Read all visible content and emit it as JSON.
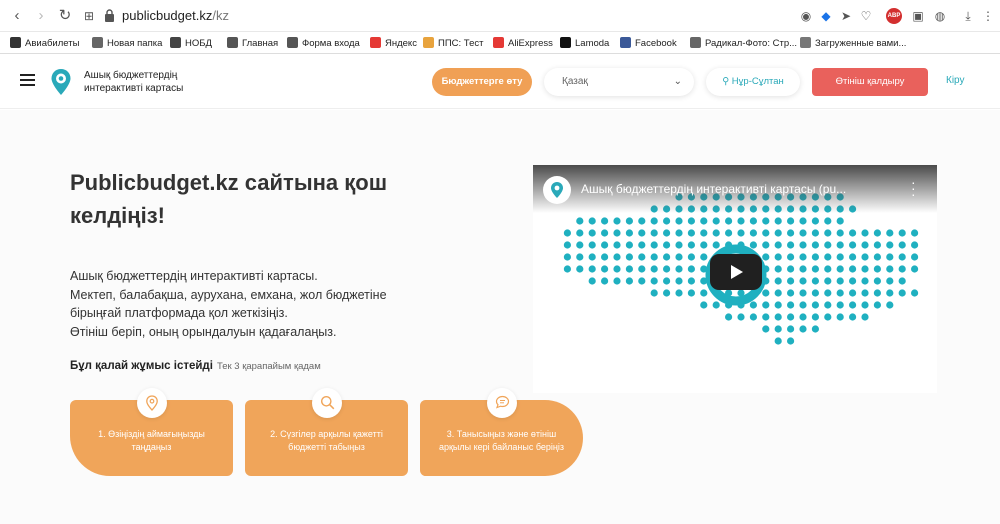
{
  "browser": {
    "url_host": "publicbudget.kz",
    "url_path": "/kz",
    "bookmarks": [
      {
        "label": "Авиабилеты",
        "color": "#333333"
      },
      {
        "label": "Новая папка",
        "color": "#666666"
      },
      {
        "label": "НОБД",
        "color": "#444444"
      },
      {
        "label": "Главная",
        "color": "#555555"
      },
      {
        "label": "Форма входа",
        "color": "#555555"
      },
      {
        "label": "Яндекс",
        "color": "#e53935"
      },
      {
        "label": "ППС: Тест",
        "color": "#e8a33d"
      },
      {
        "label": "AliExpress",
        "color": "#e53935"
      },
      {
        "label": "Lamoda",
        "color": "#111111"
      },
      {
        "label": "Facebook",
        "color": "#3b5998"
      },
      {
        "label": "Радикал-Фото: Стр...",
        "color": "#666666"
      },
      {
        "label": "Загруженные вами...",
        "color": "#777777"
      }
    ]
  },
  "header": {
    "brand": "Ашық бюджеттердің интерактивті картасы",
    "budget_button": "Бюджеттерге өту",
    "language": "Қазақ",
    "city": "Нұр-Сұлтан",
    "apply_button": "Өтініш қалдыру",
    "login": "Кіру"
  },
  "hero": {
    "title": "Publicbudget.kz сайтына қош келдіңіз!",
    "description": [
      "Ашық бюджеттердің интерактивті картасы.",
      "Мектеп, балабақша, аурухана, емхана, жол бюджетіне",
      "бірыңғай платформада қол жеткізіңіз.",
      "Өтініш беріп, оның орындалуын қадағалаңыз."
    ],
    "how_title": "Бұл қалай жұмыс істейді",
    "how_sub": "Тек 3 қарапайым қадам"
  },
  "steps": [
    {
      "label": "1. Өзіңіздің аймағыңызды таңдаңыз",
      "icon": "location-icon"
    },
    {
      "label": "2. Сүзгілер арқылы қажетті бюджетті табыңыз",
      "icon": "search-icon"
    },
    {
      "label": "3. Танысыңыз және өтініш арқылы кері байланыс беріңіз",
      "icon": "chat-icon"
    }
  ],
  "video": {
    "title": "Ашық бюджеттердің интерактивті картасы (pu..."
  },
  "colors": {
    "accent_orange": "#f0a55a",
    "accent_red": "#e9615c",
    "teal": "#2aa9b9"
  }
}
